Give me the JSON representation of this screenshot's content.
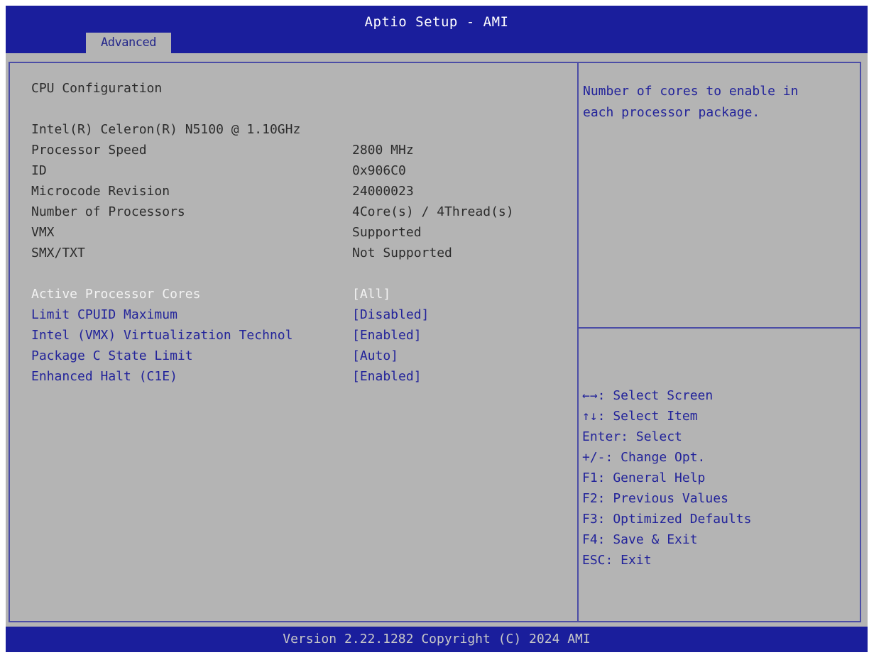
{
  "header": {
    "title": "Aptio Setup - AMI",
    "tab_label": "Advanced"
  },
  "main": {
    "section_title": "CPU Configuration",
    "processor_name": "Intel(R) Celeron(R) N5100 @ 1.10GHz",
    "info_rows": [
      {
        "label": "Processor Speed",
        "value": "2800 MHz"
      },
      {
        "label": "ID",
        "value": "0x906C0"
      },
      {
        "label": "Microcode Revision",
        "value": "24000023"
      },
      {
        "label": "Number of Processors",
        "value": "4Core(s) / 4Thread(s)"
      },
      {
        "label": "VMX",
        "value": "Supported"
      },
      {
        "label": "SMX/TXT",
        "value": "Not Supported"
      }
    ],
    "options": [
      {
        "label": "Active Processor Cores",
        "value": "[All]"
      },
      {
        "label": "Limit CPUID Maximum",
        "value": "[Disabled]"
      },
      {
        "label": "Intel (VMX) Virtualization Technol",
        "value": "[Enabled]"
      },
      {
        "label": "Package C State Limit",
        "value": "[Auto]"
      },
      {
        "label": "Enhanced Halt (C1E)",
        "value": "[Enabled]"
      }
    ]
  },
  "help": {
    "line1": "Number of cores to enable in",
    "line2": "each processor package."
  },
  "keys": [
    "←→: Select Screen",
    "↑↓: Select Item",
    "Enter: Select",
    "+/-: Change Opt.",
    "F1: General Help",
    "F2: Previous Values",
    "F3: Optimized Defaults",
    "F4: Save & Exit",
    "ESC: Exit"
  ],
  "footer": {
    "version": "Version 2.22.1282 Copyright (C) 2024 AMI"
  },
  "colors": {
    "header_blue": "#1a1e9c",
    "panel_gray": "#b4b4b4",
    "option_blue": "#22239a",
    "selected_white": "#f2f2f2"
  }
}
